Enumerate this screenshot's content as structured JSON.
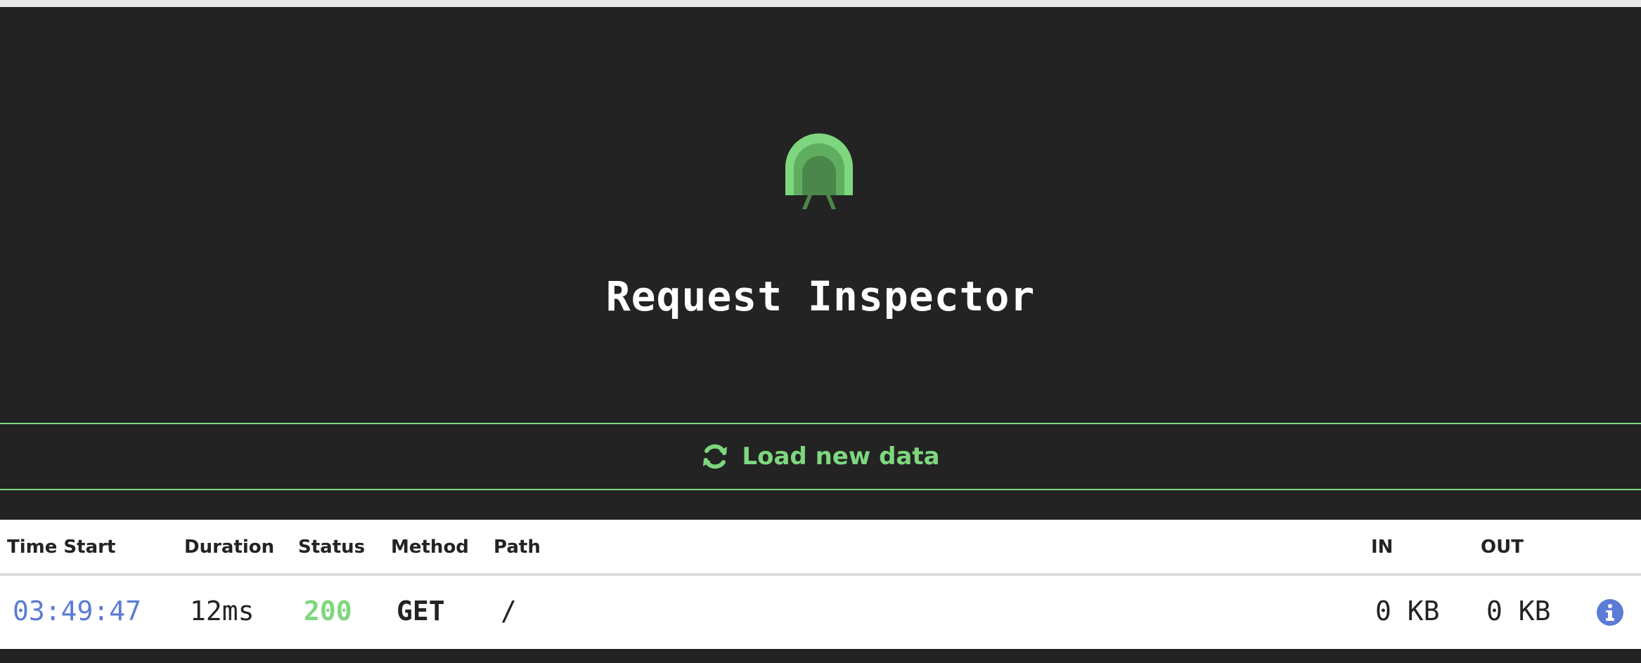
{
  "header": {
    "title": "Request Inspector",
    "logo_icon": "tunnel-logo-icon"
  },
  "actions": {
    "load_label": "Load new data",
    "load_icon": "refresh-icon"
  },
  "colors": {
    "accent": "#7ed77e",
    "time": "#5b7bd5",
    "background": "#232323",
    "info": "#5b7bd5"
  },
  "table": {
    "columns": [
      "Time Start",
      "Duration",
      "Status",
      "Method",
      "Path",
      "IN",
      "OUT"
    ],
    "rows": [
      {
        "time_start": "03:49:47",
        "duration": "12ms",
        "status": "200",
        "method": "GET",
        "path": "/",
        "in": "0 KB",
        "out": "0 KB",
        "detail_icon": "info-icon"
      }
    ]
  }
}
